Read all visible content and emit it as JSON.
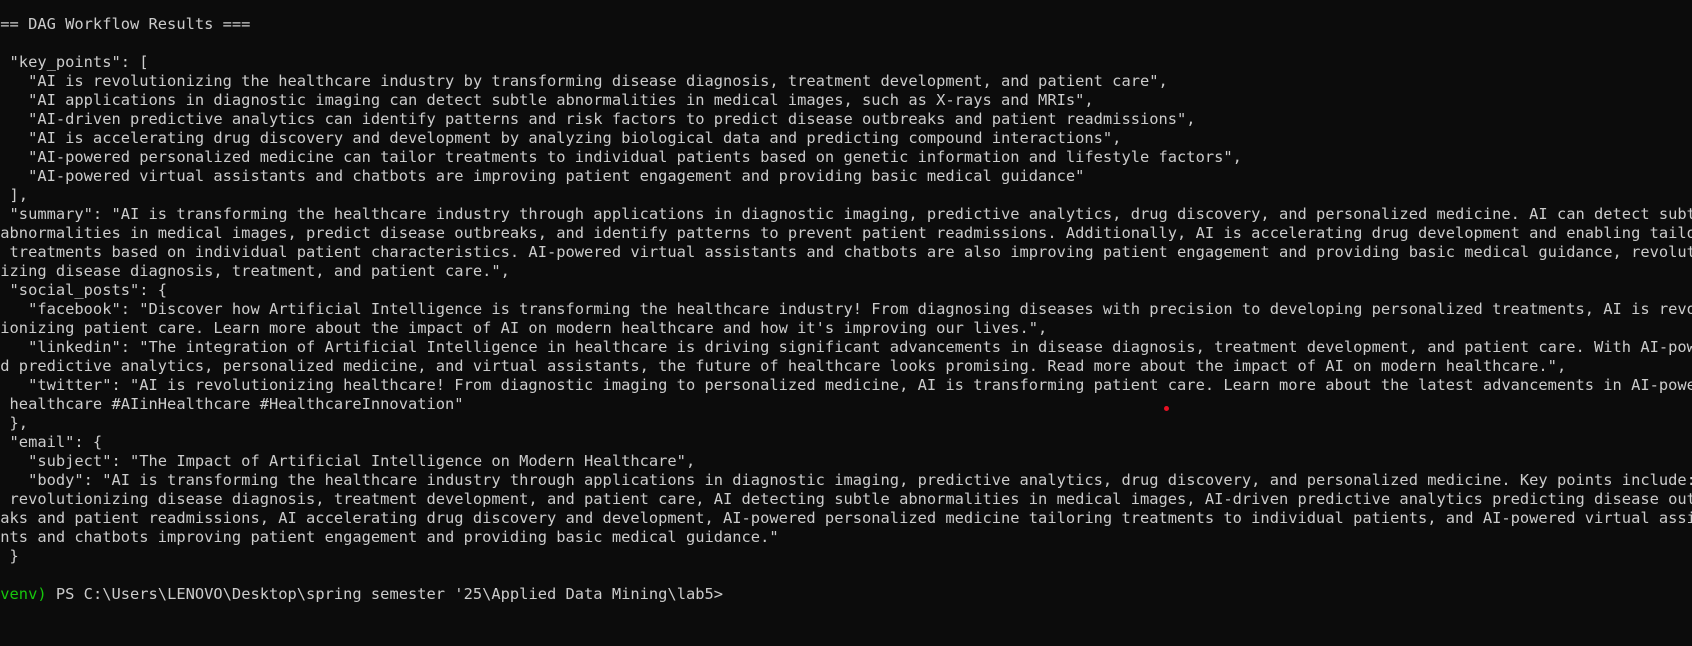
{
  "terminal": {
    "output_lines": [
      "=== DAG Workflow Results ===",
      "{",
      "  \"key_points\": [",
      "    \"AI is revolutionizing the healthcare industry by transforming disease diagnosis, treatment development, and patient care\",",
      "    \"AI applications in diagnostic imaging can detect subtle abnormalities in medical images, such as X-rays and MRIs\",",
      "    \"AI-driven predictive analytics can identify patterns and risk factors to predict disease outbreaks and patient readmissions\",",
      "    \"AI is accelerating drug discovery and development by analyzing biological data and predicting compound interactions\",",
      "    \"AI-powered personalized medicine can tailor treatments to individual patients based on genetic information and lifestyle factors\",",
      "    \"AI-powered virtual assistants and chatbots are improving patient engagement and providing basic medical guidance\"",
      "  ],",
      "  \"summary\": \"AI is transforming the healthcare industry through applications in diagnostic imaging, predictive analytics, drug discovery, and personalized medicine. AI can detect subtle",
      " abnormalities in medical images, predict disease outbreaks, and identify patterns to prevent patient readmissions. Additionally, AI is accelerating drug development and enabling tailore",
      "d treatments based on individual patient characteristics. AI-powered virtual assistants and chatbots are also improving patient engagement and providing basic medical guidance, revolutio",
      "nizing disease diagnosis, treatment, and patient care.\",",
      "  \"social_posts\": {",
      "    \"facebook\": \"Discover how Artificial Intelligence is transforming the healthcare industry! From diagnosing diseases with precision to developing personalized treatments, AI is revolu",
      "tionizing patient care. Learn more about the impact of AI on modern healthcare and how it's improving our lives.\",",
      "    \"linkedin\": \"The integration of Artificial Intelligence in healthcare is driving significant advancements in disease diagnosis, treatment development, and patient care. With AI-power",
      "ed predictive analytics, personalized medicine, and virtual assistants, the future of healthcare looks promising. Read more about the impact of AI on modern healthcare.\",",
      "    \"twitter\": \"AI is revolutionizing healthcare! From diagnostic imaging to personalized medicine, AI is transforming patient care. Learn more about the latest advancements in AI-powere",
      "d healthcare #AIinHealthcare #HealthcareInnovation\"",
      "  },",
      "  \"email\": {",
      "    \"subject\": \"The Impact of Artificial Intelligence on Modern Healthcare\",",
      "    \"body\": \"AI is transforming the healthcare industry through applications in diagnostic imaging, predictive analytics, drug discovery, and personalized medicine. Key points include: A",
      "I revolutionizing disease diagnosis, treatment development, and patient care, AI detecting subtle abnormalities in medical images, AI-driven predictive analytics predicting disease outbr",
      "eaks and patient readmissions, AI accelerating drug discovery and development, AI-powered personalized medicine tailoring treatments to individual patients, and AI-powered virtual assist",
      "ants and chatbots improving patient engagement and providing basic medical guidance.\"",
      "  }",
      "}"
    ],
    "prompt": {
      "venv": "(venv)",
      "path": " PS C:\\Users\\LENOVO\\Desktop\\spring semester '25\\Applied Data Mining\\lab5>"
    },
    "colors": {
      "background": "#0c0c0c",
      "text": "#cccccc",
      "venv": "#16c60c",
      "cursor_dot": "#e81123"
    }
  }
}
